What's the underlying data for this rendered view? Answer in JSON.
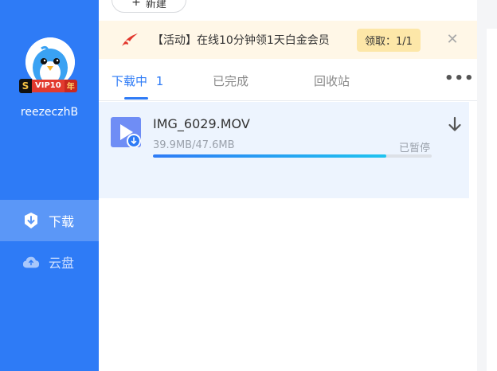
{
  "sidebar": {
    "vip": {
      "s": "S",
      "label": "VIP10",
      "year": "年"
    },
    "username": "reezeczhB",
    "items": [
      {
        "label": "下载",
        "icon": "download-shield-icon",
        "active": true
      },
      {
        "label": "云盘",
        "icon": "cloud-icon",
        "active": false
      }
    ]
  },
  "toolbar": {
    "new_label": "新建",
    "new_icon": "plus-icon"
  },
  "banner": {
    "text": "【活动】在线10分钟领1天白金会员",
    "claim_label": "领取：1/1",
    "close_icon": "close-icon",
    "logo_icon": "thunder-bird-icon"
  },
  "tabs": [
    {
      "label": "下载中",
      "count": "1",
      "active": true
    },
    {
      "label": "已完成",
      "active": false
    },
    {
      "label": "回收站",
      "active": false
    }
  ],
  "more_label": "•••",
  "download": {
    "file_name": "IMG_6029.MOV",
    "size_text": "39.9MB/47.6MB",
    "status": "已暂停",
    "progress": 0.837,
    "file_icon": "video-file-icon",
    "action_icon": "download-arrow-icon"
  },
  "colors": {
    "accent": "#2e7bf6",
    "banner_bg": "#fff7e7",
    "item_bg": "#edf4fe"
  }
}
